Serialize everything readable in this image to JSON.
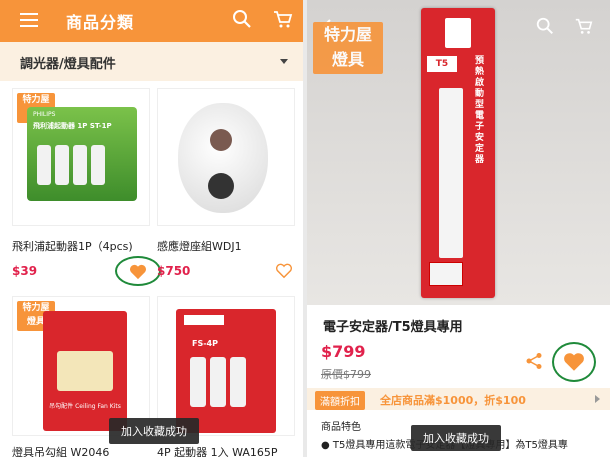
{
  "left": {
    "header": {
      "title": "商品分類"
    },
    "category": {
      "selected": "調光器/燈具配件"
    },
    "badge": {
      "line1": "特力屋",
      "line2": "燈具"
    },
    "products": [
      {
        "name": "飛利浦起動器1P（4pcs)",
        "price": "$39",
        "package_text": "飛利浦起動器 1P ST-1P",
        "package_brand": "PHILIPS",
        "favorited": true
      },
      {
        "name": "感應燈座組WDJ1",
        "price": "$750",
        "favorited": false
      },
      {
        "name": "燈具吊勾組 W2046",
        "price": "",
        "package_text": "吊勾配件 Ceiling Fan Kits"
      },
      {
        "name": "4P 起動器 1入 WA165P",
        "price": "",
        "package_text": "FS-4P"
      }
    ],
    "toast": "加入收藏成功"
  },
  "right": {
    "badge": {
      "line1": "特力屋",
      "line2": "燈具"
    },
    "product_box_text": "預熱啟動型電子安定器",
    "product_box_label": "T5",
    "title": "電子安定器/T5燈具專用",
    "price": "$799",
    "original_price": "原價$799",
    "promo": {
      "tag": "滿額折扣",
      "text": "全店商品滿$1000，折$100"
    },
    "features_title": "商品特色",
    "feature_line": "● T5燈具專用這款電子安定器【燈具專用】為T5燈具專",
    "toast": "加入收藏成功"
  },
  "colors": {
    "brand_orange": "#f7943a",
    "price_red": "#e1224c",
    "highlight_green": "#1f8a3a"
  }
}
